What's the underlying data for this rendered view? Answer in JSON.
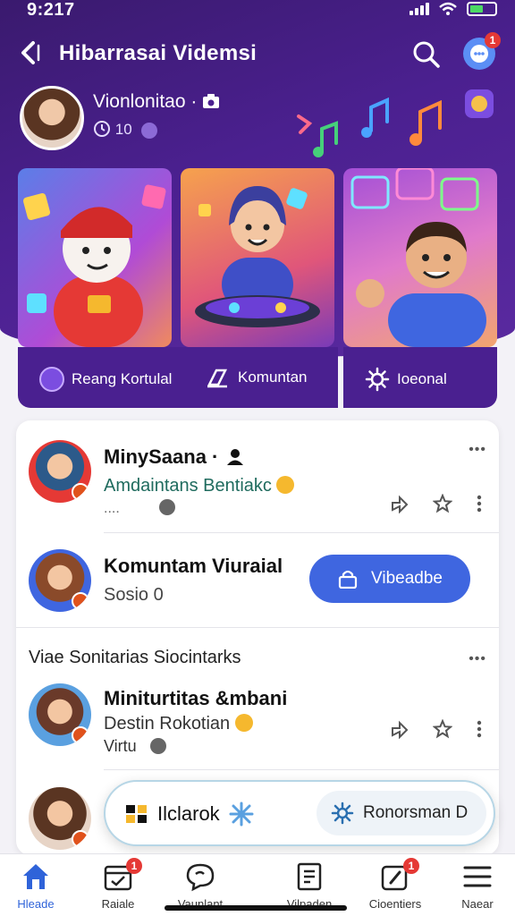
{
  "status_bar": {
    "time": "9:217"
  },
  "header": {
    "back_label": "<",
    "title": "Hibarrasai Videmsi",
    "chat_badge": "1"
  },
  "profile": {
    "name": "Vionlonitao ·",
    "stat": "10"
  },
  "hero": {
    "actions": [
      {
        "label": "Reang Kortulal"
      },
      {
        "label": "Komuntan"
      },
      {
        "label": "Ioeonal"
      }
    ]
  },
  "feed": {
    "items": [
      {
        "title": "MinySaana ·",
        "subtitle": "Amdaintans Bentiakc",
        "meta": "....",
        "more": "•••"
      },
      {
        "title": "Komuntam Viuraial",
        "subtitle": "Sosio 0",
        "button": "Vibeadbe"
      },
      {
        "title": "Miniturtitas &mbani",
        "subtitle": "Destin Rokotian",
        "meta": "Virtu",
        "more": "•••"
      },
      {
        "title": "",
        "subtitle": ""
      }
    ],
    "section_label": "Viae Sonitarias Siocintarks"
  },
  "float_bar": {
    "left_label": "Ilclarok",
    "right_label": "Ronorsman D"
  },
  "tabs": [
    {
      "label": "Hleade",
      "active": true,
      "icon": "home-icon"
    },
    {
      "label": "Raiale",
      "badge": "1",
      "icon": "calendar-icon"
    },
    {
      "label": "Vaunlant",
      "icon": "chat-bubble-icon"
    },
    {
      "label": "Vilpaden",
      "icon": "document-icon"
    },
    {
      "label": "Cioentiers",
      "badge": "1",
      "icon": "edit-icon"
    },
    {
      "label": "Naear",
      "icon": "menu-icon"
    }
  ],
  "colors": {
    "header_bg": "#4b2090",
    "accent_blue": "#3f66e0",
    "badge_red": "#e53935",
    "active_tab": "#2f63d9"
  }
}
